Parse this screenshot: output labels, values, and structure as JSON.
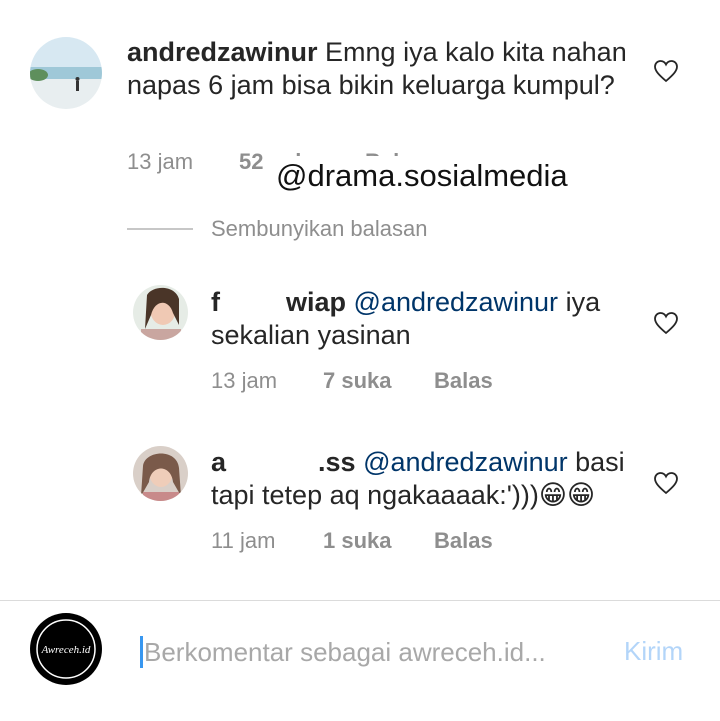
{
  "comment": {
    "username": "andredzawinur",
    "text": " Emng iya kalo kita nahan napas 6 jam bisa bikin keluarga kumpul?",
    "time": "13 jam",
    "likes": "52 suka",
    "reply": "Balas"
  },
  "watermark": "@drama.sosialmedia",
  "hide_replies": "Sembunyikan balasan",
  "replies": [
    {
      "username_start": "f",
      "username_end": "wiap",
      "mention": "@andredzawinur",
      "text_line1": " iya",
      "text_line2": "sekalian yasinan",
      "time": "13 jam",
      "likes": "7 suka",
      "reply": "Balas"
    },
    {
      "username_start": "a",
      "username_end": ".ss",
      "mention": "@andredzawinur",
      "text_line1": " basi",
      "text_line2": "tapi tetep aq ngakaaaak:')))😁😁",
      "time": "11 jam",
      "likes": "1 suka",
      "reply": "Balas"
    }
  ],
  "composer": {
    "avatar_text": "Awreceh.id",
    "placeholder": "Berkomentar sebagai awreceh.id...",
    "send_label": "Kirim"
  },
  "colors": {
    "text": "#262626",
    "secondary": "#8e8e8e",
    "mention": "#003569",
    "caret": "#3897f0",
    "send": "#b3d5f9"
  }
}
